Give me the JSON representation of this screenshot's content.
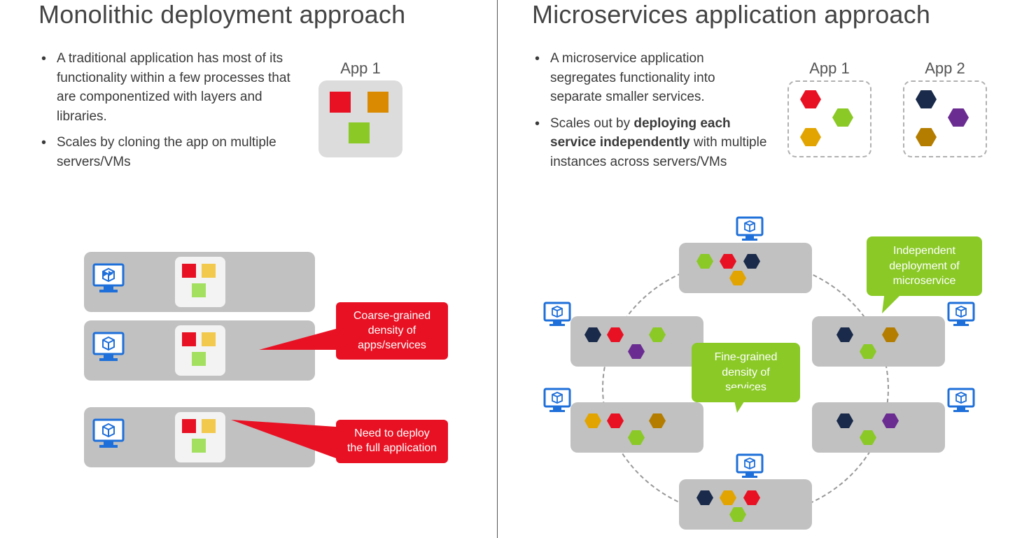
{
  "left": {
    "title": "Monolithic deployment approach",
    "bullets": [
      "A traditional application has most of its functionality within a few processes that are componentized with layers and libraries.",
      "Scales by cloning the app on multiple servers/VMs"
    ],
    "app_label": "App 1",
    "callout1": "Coarse-grained density of apps/services",
    "callout2": "Need to deploy the full application"
  },
  "right": {
    "title": "Microservices application approach",
    "bullet1": "A microservice application segregates functionality into separate smaller services.",
    "bullet2a": "Scales out by ",
    "bullet2b": "deploying each service independently",
    "bullet2c": " with multiple instances across servers/VMs",
    "app1_label": "App 1",
    "app2_label": "App 2",
    "callout_center": "Fine-grained density of services",
    "callout_right": "Independent deployment of microservice"
  },
  "colors": {
    "red": "#e81123",
    "green": "#8ac926",
    "blue": "#1e6fd9"
  }
}
